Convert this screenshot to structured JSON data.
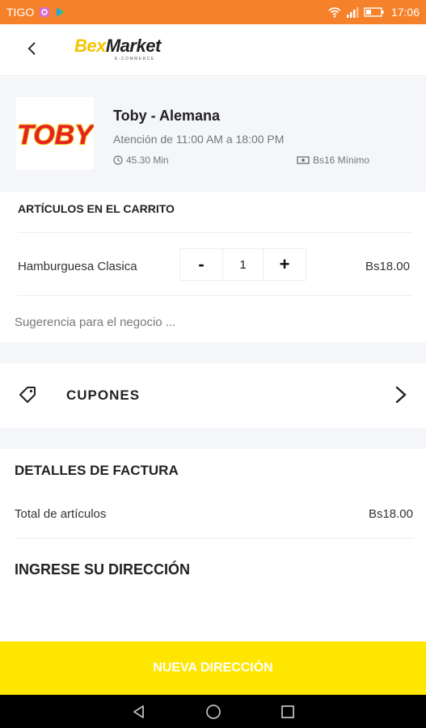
{
  "status_bar": {
    "carrier": "TIGO",
    "time": "17:06",
    "background": "#f5822a"
  },
  "header": {
    "logo_part1": "Bex",
    "logo_part2": "Market",
    "logo_sub": "E-COMMERCE",
    "back_icon": "chevron-left-icon"
  },
  "store": {
    "logo_text": "TOBY",
    "name": "Toby - Alemana",
    "hours": "Atención de 11:00 AM a 18:00 PM",
    "delivery_time": "45.30 Min",
    "minimum": "Bs16 Mínimo"
  },
  "cart": {
    "title": "ARTÍCULOS EN EL CARRITO",
    "items": [
      {
        "name": "Hamburguesa Clasica",
        "quantity": "1",
        "price": "Bs18.00",
        "minus_label": "-",
        "plus_label": "+"
      }
    ],
    "suggestion_placeholder": "Sugerencia para el negocio ..."
  },
  "coupons": {
    "label": "CUPONES",
    "icon": "tag-icon"
  },
  "invoice": {
    "title": "DETALLES DE FACTURA",
    "total_label": "Total de artículos",
    "total_value": "Bs18.00"
  },
  "address": {
    "title": "INGRESE SU DIRECCIÓN"
  },
  "cta": {
    "label": "NUEVA DIRECCIÓN",
    "color": "#ffe600"
  },
  "colors": {
    "accent_orange": "#f5822a",
    "accent_yellow": "#ffe600",
    "logo_red": "#e4202a",
    "logo_yellow": "#f5c400",
    "section_bg": "#f4f6f9"
  }
}
